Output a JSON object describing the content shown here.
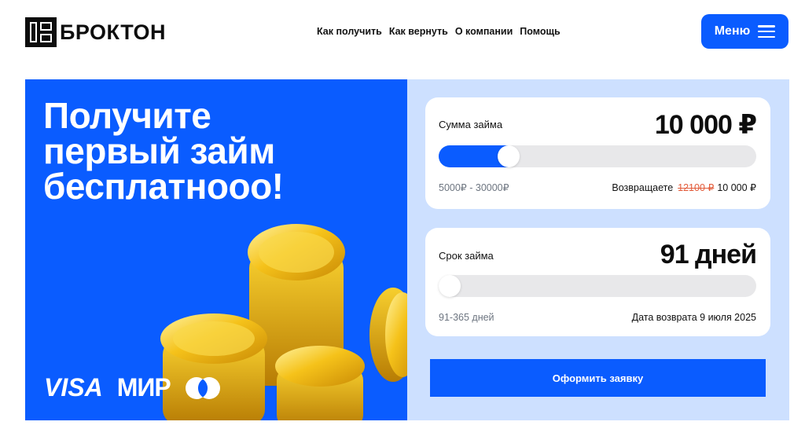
{
  "brand": {
    "name": "БРОКТОН"
  },
  "nav": {
    "items": [
      "Как получить",
      "Как вернуть",
      "О компании",
      "Помощь"
    ]
  },
  "menu_button": {
    "label": "Меню"
  },
  "hero": {
    "title_line1": "Получите",
    "title_line2": "первый займ",
    "title_line3": "бесплатнооо!",
    "payment_visa": "VISA",
    "payment_mir": "МИР"
  },
  "loan_amount": {
    "label": "Сумма займа",
    "value": "10 000 ₽",
    "range": "5000₽ - 30000₽",
    "return_label": "Возвращаете",
    "old_amount": "12100 ₽",
    "new_amount": "10 000 ₽",
    "slider_fraction": 0.2
  },
  "loan_term": {
    "label": "Срок займа",
    "value": "91 дней",
    "range": "91-365 дней",
    "return_date_label": "Дата возврата",
    "return_date": "9 июля 2025",
    "slider_fraction": 0.0
  },
  "submit_button": {
    "label": "Оформить заявку"
  },
  "colors": {
    "accent": "#0a5cff",
    "panel_bg": "#cde0ff",
    "strike": "#e25b3a"
  }
}
